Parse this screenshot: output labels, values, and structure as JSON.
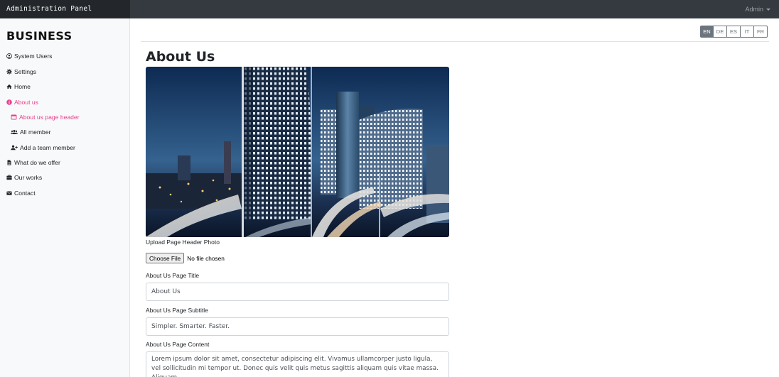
{
  "navbar": {
    "brand": "Administration Panel",
    "user": "Admin"
  },
  "sidebar": {
    "logo": "BUSINESS",
    "items": [
      {
        "label": "System Users",
        "icon": "user-circle-icon"
      },
      {
        "label": "Settings",
        "icon": "gear-icon"
      },
      {
        "label": "Home",
        "icon": "home-icon"
      },
      {
        "label": "About us",
        "icon": "info-circle-icon",
        "active": true
      },
      {
        "label": "About us page header",
        "icon": "window-icon",
        "active": true
      },
      {
        "label": "All member",
        "icon": "users-icon"
      },
      {
        "label": "Add a team member",
        "icon": "user-plus-icon"
      },
      {
        "label": "What do we offer",
        "icon": "file-icon"
      },
      {
        "label": "Our works",
        "icon": "briefcase-icon"
      },
      {
        "label": "Contact",
        "icon": "envelope-icon"
      }
    ]
  },
  "languages": [
    "EN",
    "DE",
    "ES",
    "IT",
    "FR"
  ],
  "active_language": "EN",
  "main": {
    "title": "About Us",
    "upload_label": "Upload Page Header Photo",
    "file_button": "Choose File",
    "file_status": "No file chosen",
    "title_label": "About Us Page Title",
    "title_value": "About Us",
    "subtitle_label": "About Us Page Subtitle",
    "subtitle_value": "Simpler. Smarter. Faster.",
    "content_label": "About Us Page Content",
    "content_value": "Lorem ipsum dolor sit amet, consectetur adipiscing elit. Vivamus ullamcorper justo ligula, vel sollicitudin mi tempor ut. Donec quis velit quis metus sagittis aliquam quis vitae massa. Aliquam"
  },
  "colors": {
    "navbar": "#343a40",
    "accent": "#e83e8c",
    "sidebar_bg": "#f8f9fa"
  }
}
